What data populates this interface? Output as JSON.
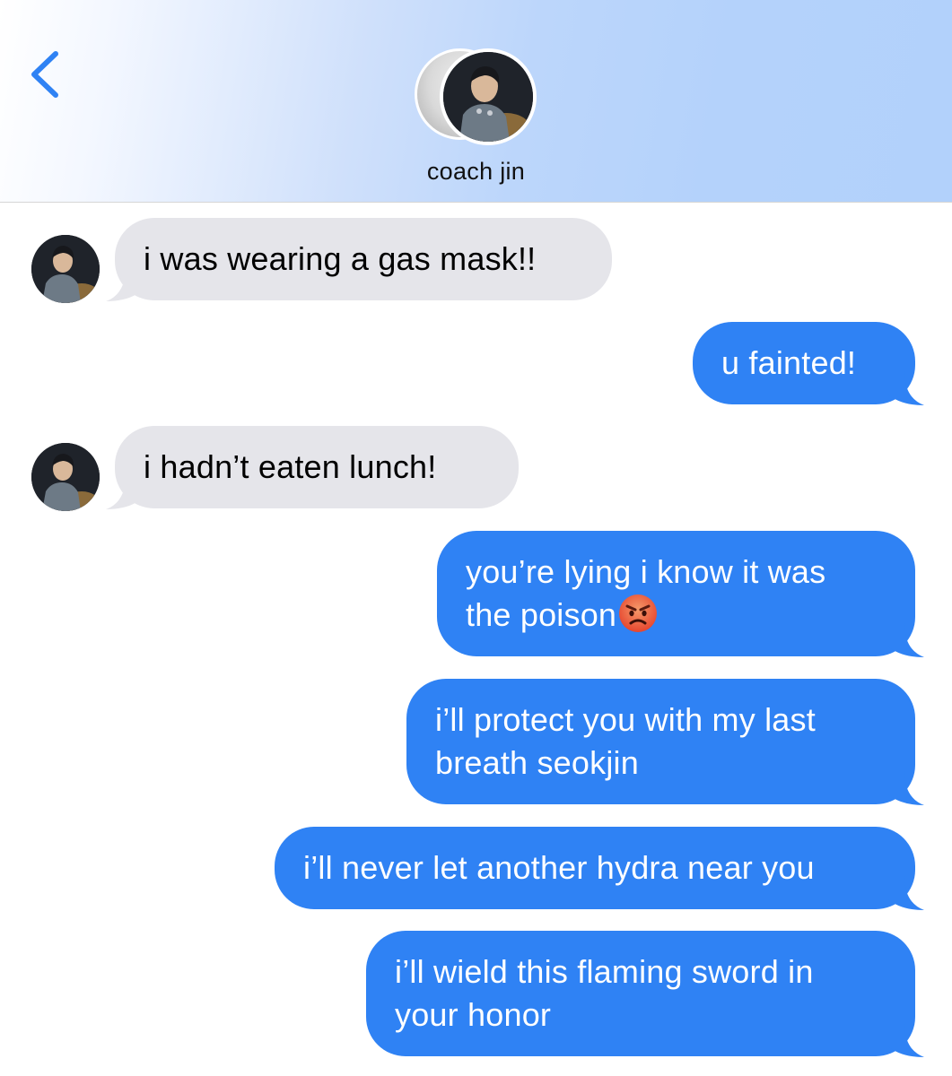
{
  "header": {
    "contact_name": "coach jin",
    "back_icon": "chevron-left-icon",
    "accent_color": "#2f82f4"
  },
  "messages": [
    {
      "direction": "incoming",
      "lines": [
        "i was wearing a gas mask!!"
      ]
    },
    {
      "direction": "outgoing",
      "lines": [
        "u fainted!"
      ]
    },
    {
      "direction": "incoming",
      "lines": [
        "i hadn’t eaten lunch!"
      ]
    },
    {
      "direction": "outgoing",
      "lines": [
        "you’re lying i know it was",
        "the poison"
      ],
      "emoji": "angry-face-emoji"
    },
    {
      "direction": "outgoing",
      "lines": [
        "i’ll protect you with my last",
        "breath seokjin"
      ]
    },
    {
      "direction": "outgoing",
      "lines": [
        "i’ll never let another hydra near you"
      ]
    },
    {
      "direction": "outgoing",
      "lines": [
        "i’ll wield this flaming sword in",
        "your honor"
      ]
    }
  ],
  "colors": {
    "incoming_bubble": "#e5e5ea",
    "outgoing_bubble": "#2f82f4",
    "outgoing_text": "#ffffff"
  }
}
